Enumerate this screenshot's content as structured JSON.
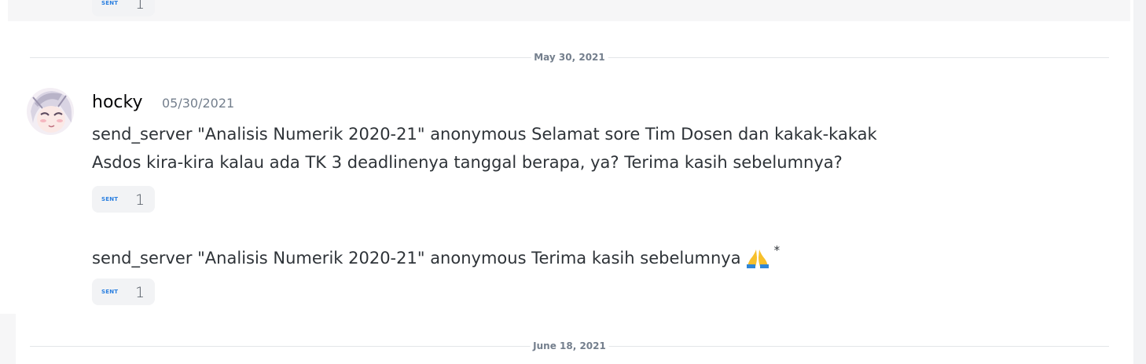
{
  "previous_message": {
    "reaction": {
      "emoji_text": "SENT",
      "count": "1"
    }
  },
  "dividers": [
    {
      "label": "May 30, 2021"
    },
    {
      "label": "June 18, 2021"
    }
  ],
  "message_group": {
    "username": "hocky",
    "timestamp": "05/30/2021",
    "messages": [
      {
        "line1": "send_server \"Analisis Numerik 2020-21\" anonymous Selamat sore Tim Dosen dan kakak-kakak",
        "line2": "Asdos kira-kira kalau ada TK 3 deadlinenya tanggal berapa, ya? Terima kasih sebelumnya?",
        "reaction": {
          "emoji_text": "SENT",
          "count": "1"
        }
      },
      {
        "text": "send_server \"Analisis Numerik 2020-21\" anonymous Terima kasih sebelumnya",
        "emoji_icon": "folded-hands",
        "suffix": "*",
        "reaction": {
          "emoji_text": "SENT",
          "count": "1"
        }
      }
    ]
  },
  "colors": {
    "reaction_emoji": "#2a7fe0",
    "divider_text": "#747f8d",
    "timestamp": "#747f8d",
    "message_text": "#2e3338"
  }
}
